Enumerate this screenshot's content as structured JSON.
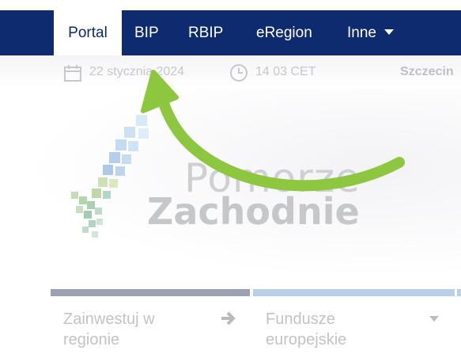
{
  "nav": {
    "tabs": [
      {
        "label": "Portal"
      },
      {
        "label": "BIP"
      },
      {
        "label": "RBIP"
      },
      {
        "label": "eRegion"
      },
      {
        "label": "Inne"
      }
    ]
  },
  "infobar": {
    "date": "22 stycznia 2024",
    "time": "14 03 CET",
    "city": "Szczecin"
  },
  "logo": {
    "line1": "Pomorze",
    "line2": "Zachodnie"
  },
  "cards": [
    {
      "label_line1": "Zainwestuj w",
      "label_line2": "regionie",
      "icon": "arrow-right-icon"
    },
    {
      "label_line1": "Fundusze",
      "label_line2": "europejskie",
      "icon": "caret-down-icon"
    }
  ],
  "colors": {
    "nav_bg": "#0d2b6e",
    "annotation_arrow": "#8dc63f",
    "card1_bar": "#9aa1b3",
    "card2_bar": "#b8cfe8"
  }
}
